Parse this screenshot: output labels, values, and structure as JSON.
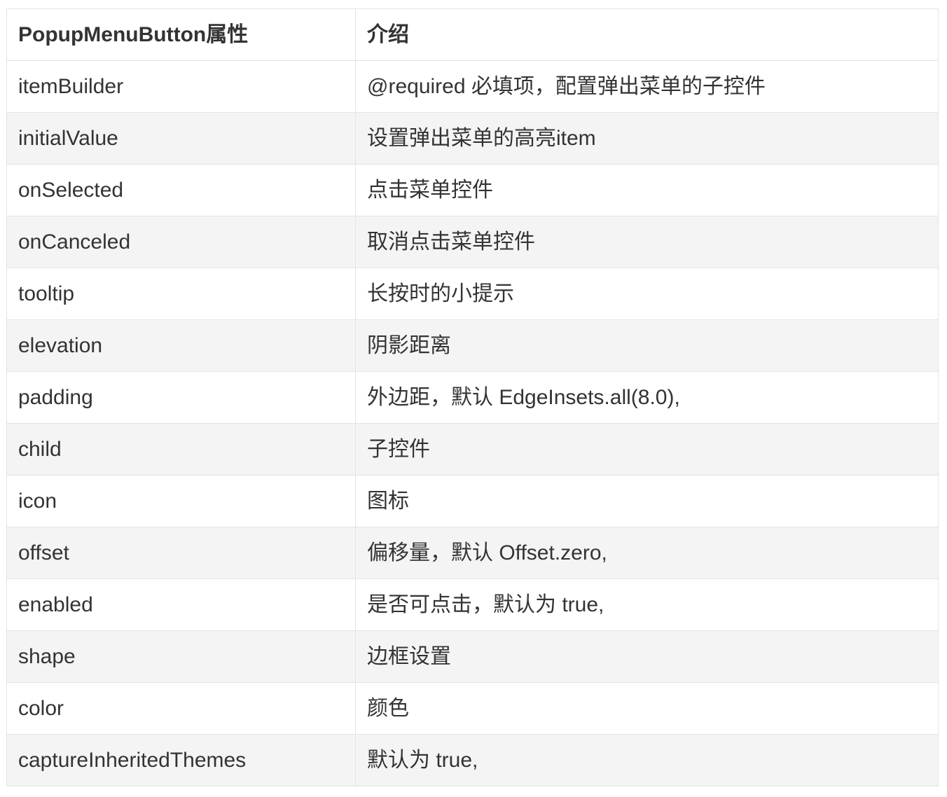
{
  "table": {
    "headers": [
      "PopupMenuButton属性",
      "介绍"
    ],
    "rows": [
      [
        "itemBuilder",
        "@required 必填项，配置弹出菜单的子控件"
      ],
      [
        "initialValue",
        "设置弹出菜单的高亮item"
      ],
      [
        "onSelected",
        "点击菜单控件"
      ],
      [
        "onCanceled",
        "取消点击菜单控件"
      ],
      [
        "tooltip",
        "长按时的小提示"
      ],
      [
        "elevation",
        "阴影距离"
      ],
      [
        "padding",
        "外边距，默认 EdgeInsets.all(8.0),"
      ],
      [
        "child",
        "子控件"
      ],
      [
        "icon",
        "图标"
      ],
      [
        "offset",
        "偏移量，默认 Offset.zero,"
      ],
      [
        "enabled",
        "是否可点击，默认为 true,"
      ],
      [
        "shape",
        "边框设置"
      ],
      [
        "color",
        "颜色"
      ],
      [
        "captureInheritedThemes",
        "默认为 true,"
      ]
    ]
  }
}
